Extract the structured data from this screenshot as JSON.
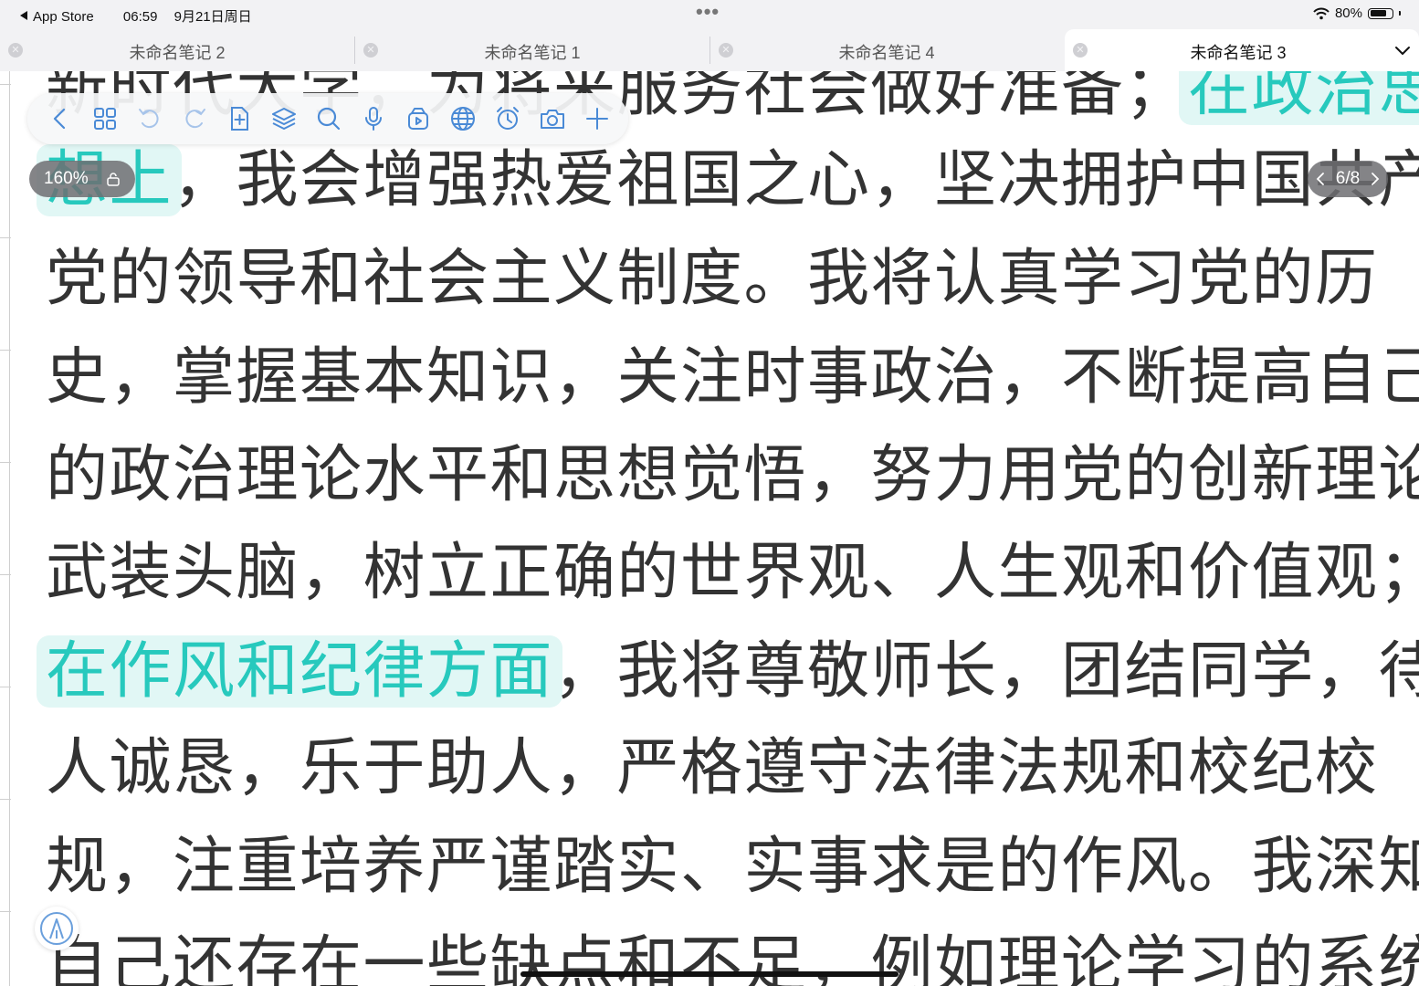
{
  "status_bar": {
    "back_app": "App Store",
    "time": "06:59",
    "date": "9月21日周日",
    "multitask": "•••",
    "battery_percent": "80%",
    "battery_level": 0.8
  },
  "tabs": [
    {
      "label": "未命名笔记 2",
      "active": false
    },
    {
      "label": "未命名笔记 1",
      "active": false
    },
    {
      "label": "未命名笔记 4",
      "active": false
    },
    {
      "label": "未命名笔记 3",
      "active": true
    }
  ],
  "toolbar": {
    "buttons": [
      "back-icon",
      "grid-icon",
      "undo-icon",
      "redo-icon",
      "add-page-icon",
      "layers-icon",
      "search-icon",
      "microphone-icon",
      "clip-icon",
      "globe-icon",
      "timer-icon",
      "camera-icon",
      "add-icon"
    ]
  },
  "zoom": {
    "label": "160%"
  },
  "page_indicator": {
    "label": "6/8"
  },
  "note": {
    "lines": [
      {
        "pre": "新时代大学，为将来服务社会做好准备；",
        "hl": "在政治思",
        "post": ""
      },
      {
        "pre": "",
        "hl": "想上",
        "post": "，我会增强热爱祖国之心，坚决拥护中国共产"
      },
      {
        "pre": "党的领导和社会主义制度。我将认真学习党的历",
        "hl": "",
        "post": ""
      },
      {
        "pre": "史，掌握基本知识，关注时事政治，不断提高自己",
        "hl": "",
        "post": ""
      },
      {
        "pre": "的政治理论水平和思想觉悟，努力用党的创新理论",
        "hl": "",
        "post": ""
      },
      {
        "pre": "武装头脑，树立正确的世界观、人生观和价值观；",
        "hl": "",
        "post": ""
      },
      {
        "pre": "",
        "hl": "在作风和纪律方面",
        "post": "，我将尊敬师长，团结同学，待"
      },
      {
        "pre": "人诚恳，乐于助人，严格遵守法律法规和校纪校",
        "hl": "",
        "post": ""
      },
      {
        "pre": "规，注重培养严谨踏实、实事求是的作风。我深知",
        "hl": "",
        "post": ""
      },
      {
        "pre": "自己还存在一些缺点和不足，例如理论学习的系统",
        "hl": "",
        "post": ""
      }
    ]
  },
  "colors": {
    "highlight_bg": "#e1f7f5",
    "highlight_text": "#27c9bd",
    "body_text": "#333333",
    "chrome_bg": "#f2f2f4"
  }
}
